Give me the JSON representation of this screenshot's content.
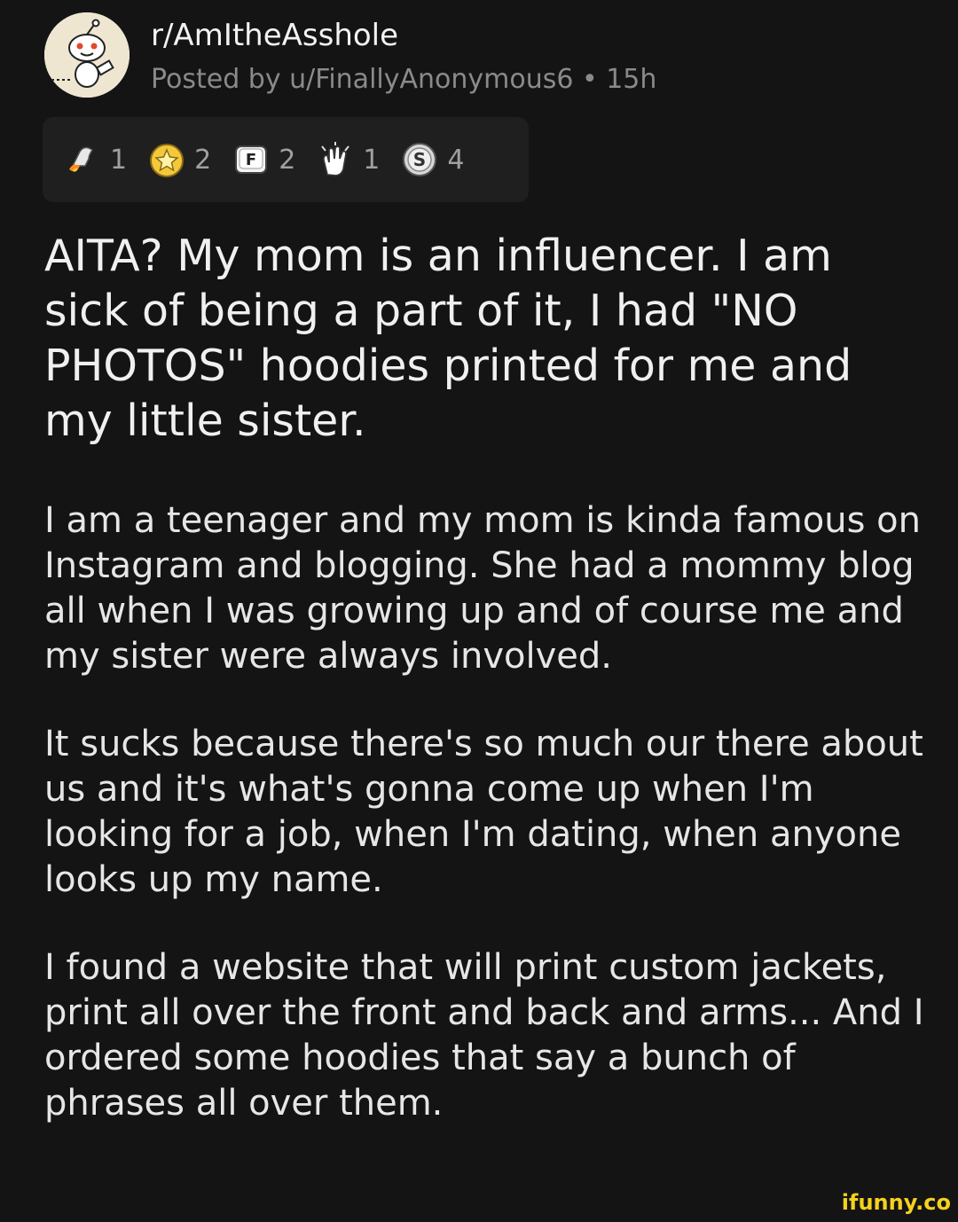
{
  "post": {
    "subreddit": "r/AmItheAsshole",
    "meta": "Posted by u/FinallyAnonymous6 • 15h",
    "title": "AITA? My mom is an influencer. I am sick of being a part of it, I had \"NO PHOTOS\" hoodies printed for me and my little sister.",
    "paragraphs": [
      "I am a teenager and my mom is kinda famous on Instagram and blogging. She had a mommy blog all when I was growing up and of course me and my sister were always involved.",
      "It sucks because there's so much our there about us and it's what's gonna come up when I'm looking for a job, when I'm dating, when anyone looks up my name.",
      "I found a website that will print custom jackets, print all over the front and back and arms... And I ordered some hoodies that say a bunch of phrases all over them."
    ]
  },
  "awards": [
    {
      "icon": "rocket-like-icon",
      "count": "1"
    },
    {
      "icon": "helpful-award-icon",
      "count": "2"
    },
    {
      "icon": "press-f-award-icon",
      "count": "2"
    },
    {
      "icon": "clapping-hands-icon",
      "count": "1"
    },
    {
      "icon": "silver-award-icon",
      "count": "4"
    }
  ],
  "watermark": "ifunny.co",
  "colors": {
    "background": "#141414",
    "award_bar": "#1f1f1f",
    "muted_text": "#8a8a8a",
    "watermark": "#f5d11d"
  }
}
